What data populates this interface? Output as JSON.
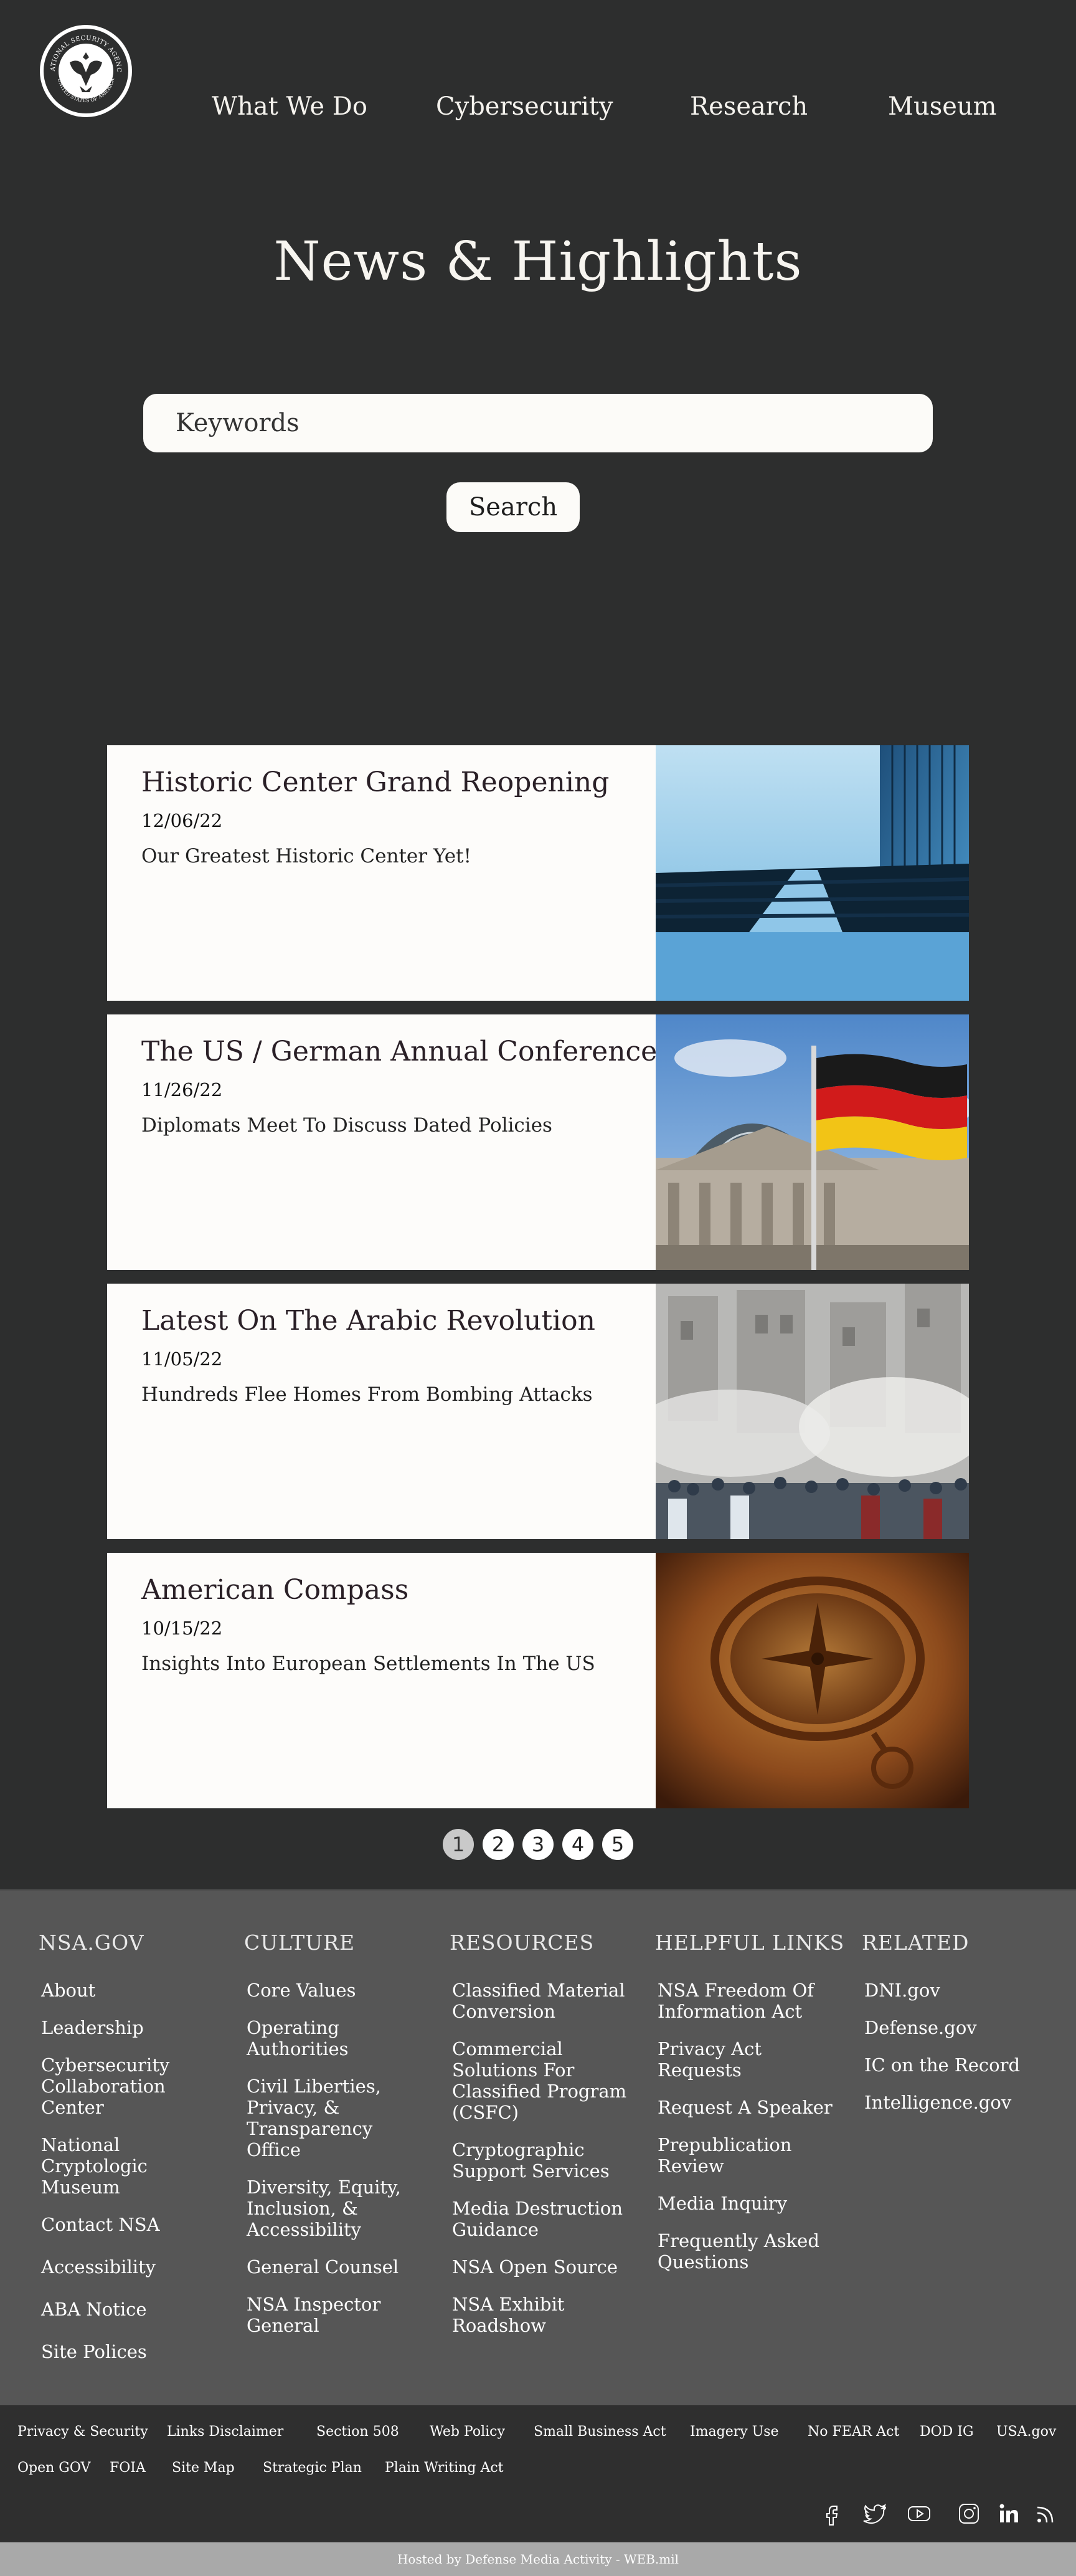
{
  "header": {
    "logo_text_top": "NATIONAL SECURITY AGENCY",
    "logo_text_bottom": "UNITED STATES OF AMERICA",
    "nav": [
      {
        "label": "What We Do"
      },
      {
        "label": "Cybersecurity"
      },
      {
        "label": "Research"
      },
      {
        "label": "Museum"
      }
    ]
  },
  "hero": {
    "title": "News & Highlights",
    "search_placeholder": "Keywords",
    "search_button": "Search"
  },
  "news": [
    {
      "title": "Historic Center Grand Reopening",
      "date": "12/06/22",
      "description": "Our Greatest Historic Center Yet!",
      "image": "glass-building-photo"
    },
    {
      "title": "The US / German Annual Conference",
      "date": "11/26/22",
      "description": "Diplomats Meet To Discuss Dated Policies",
      "image": "reichstag-german-flag-photo"
    },
    {
      "title": "Latest On The Arabic Revolution",
      "date": "11/05/22",
      "description": "Hundreds Flee Homes From Bombing Attacks",
      "image": "crowd-smoke-photo"
    },
    {
      "title": "American Compass",
      "date": "10/15/22",
      "description": "Insights Into European Settlements In The US",
      "image": "antique-compass-photo"
    }
  ],
  "pagination": {
    "pages": [
      "1",
      "2",
      "3",
      "4",
      "5"
    ],
    "current": "1"
  },
  "footer": {
    "columns": [
      {
        "heading": "NSA.GOV",
        "links": [
          "About",
          "Leadership",
          "Cybersecurity Collaboration Center",
          "National Cryptologic Museum",
          "Contact NSA",
          "Accessibility",
          "ABA Notice",
          "Site Polices"
        ]
      },
      {
        "heading": "CULTURE",
        "links": [
          "Core Values",
          "Operating Authorities",
          "Civil Liberties, Privacy, & Transparency Office",
          "Diversity, Equity, Inclusion, & Accessibility",
          "General Counsel",
          "NSA Inspector General"
        ]
      },
      {
        "heading": "RESOURCES",
        "links": [
          "Classified Material Conversion",
          "Commercial Solutions For Classified Program (CSFC)",
          "Cryptographic Support Services",
          "Media Destruction Guidance",
          "NSA Open Source",
          "NSA Exhibit Roadshow"
        ]
      },
      {
        "heading": "HELPFUL LINKS",
        "links": [
          "NSA Freedom Of Information Act",
          "Privacy Act Requests",
          "Request A Speaker",
          "Prepublication Review",
          "Media Inquiry",
          "Frequently Asked Questions"
        ]
      },
      {
        "heading": "RELATED",
        "links": [
          "DNI.gov",
          "Defense.gov",
          "IC on the Record",
          "Intelligence.gov"
        ]
      }
    ],
    "bottom_links_row1": [
      "Privacy & Security",
      "Links Disclaimer",
      "Section 508",
      "Web Policy",
      "Small Business Act",
      "Imagery Use",
      "No FEAR Act",
      "DOD IG",
      "USA.gov"
    ],
    "bottom_links_row2": [
      "Open GOV",
      "FOIA",
      "Site Map",
      "Strategic Plan",
      "Plain Writing Act"
    ],
    "social": [
      "facebook-icon",
      "twitter-icon",
      "youtube-icon",
      "instagram-icon",
      "linkedin-icon",
      "rss-icon"
    ],
    "hosted": "Hosted by Defense Media Activity - WEB.mil"
  }
}
